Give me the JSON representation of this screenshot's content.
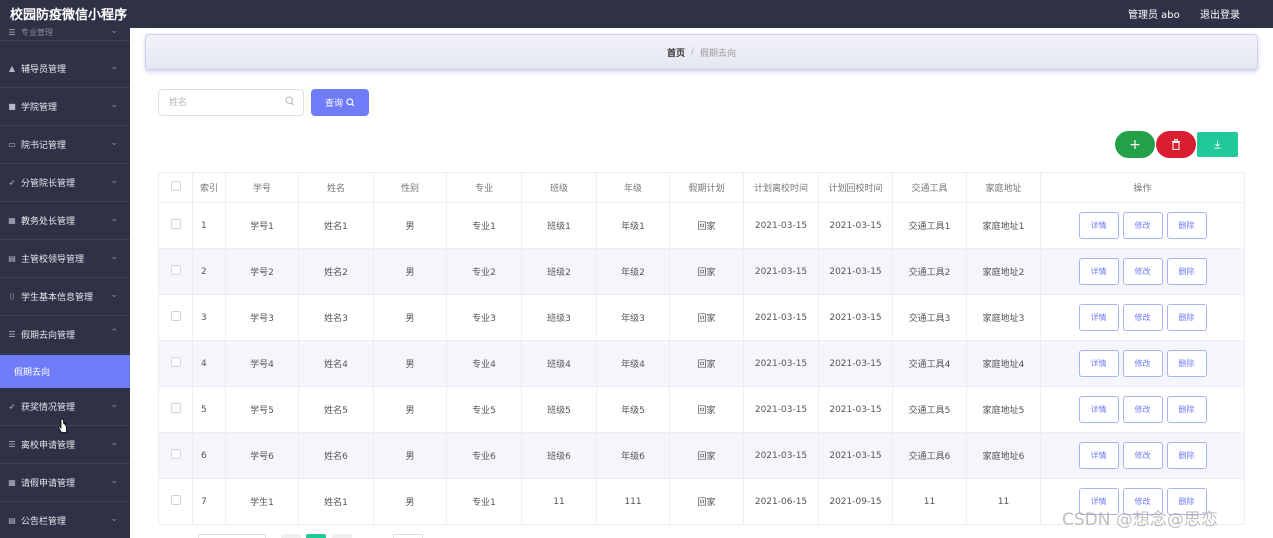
{
  "header": {
    "app_title": "校园防疫微信小程序",
    "admin_label": "管理员 abo",
    "logout_label": "退出登录"
  },
  "sidebar": {
    "items": [
      {
        "label": "专业管理",
        "icon": "list-icon"
      },
      {
        "label": "辅导员管理",
        "icon": "bank-icon"
      },
      {
        "label": "学院管理",
        "icon": "building-icon"
      },
      {
        "label": "院书记管理",
        "icon": "card-icon"
      },
      {
        "label": "分管院长管理",
        "icon": "send-icon"
      },
      {
        "label": "教务处长管理",
        "icon": "table-icon"
      },
      {
        "label": "主管校领导管理",
        "icon": "doc-icon"
      },
      {
        "label": "学生基本信息管理",
        "icon": "frame-icon"
      },
      {
        "label": "假期去向管理",
        "icon": "list-icon"
      },
      {
        "label": "获奖情况管理",
        "icon": "send-icon"
      },
      {
        "label": "离校申请管理",
        "icon": "list-icon"
      },
      {
        "label": "请假申请管理",
        "icon": "grid-icon"
      },
      {
        "label": "公告栏管理",
        "icon": "doc-icon"
      }
    ],
    "active_sub": "假期去向"
  },
  "breadcrumb": {
    "home": "首页",
    "separator": "/",
    "current": "假期去向"
  },
  "search": {
    "placeholder": "姓名",
    "value": "",
    "button_label": "查询"
  },
  "actions": {
    "add": "+",
    "delete_icon": "trash-icon",
    "download_icon": "download-icon"
  },
  "table": {
    "columns": [
      "",
      "索引",
      "学号",
      "姓名",
      "性别",
      "专业",
      "班级",
      "年级",
      "假期计划",
      "计划离校时间",
      "计划回校时间",
      "交通工具",
      "家庭地址",
      "操作"
    ],
    "rows": [
      [
        "1",
        "学号1",
        "姓名1",
        "男",
        "专业1",
        "班级1",
        "年级1",
        "回家",
        "2021-03-15",
        "2021-03-15",
        "交通工具1",
        "家庭地址1"
      ],
      [
        "2",
        "学号2",
        "姓名2",
        "男",
        "专业2",
        "班级2",
        "年级2",
        "回家",
        "2021-03-15",
        "2021-03-15",
        "交通工具2",
        "家庭地址2"
      ],
      [
        "3",
        "学号3",
        "姓名3",
        "男",
        "专业3",
        "班级3",
        "年级3",
        "回家",
        "2021-03-15",
        "2021-03-15",
        "交通工具3",
        "家庭地址3"
      ],
      [
        "4",
        "学号4",
        "姓名4",
        "男",
        "专业4",
        "班级4",
        "年级4",
        "回家",
        "2021-03-15",
        "2021-03-15",
        "交通工具4",
        "家庭地址4"
      ],
      [
        "5",
        "学号5",
        "姓名5",
        "男",
        "专业5",
        "班级5",
        "年级5",
        "回家",
        "2021-03-15",
        "2021-03-15",
        "交通工具5",
        "家庭地址5"
      ],
      [
        "6",
        "学号6",
        "姓名6",
        "男",
        "专业6",
        "班级6",
        "年级6",
        "回家",
        "2021-03-15",
        "2021-03-15",
        "交通工具6",
        "家庭地址6"
      ],
      [
        "7",
        "学生1",
        "姓名1",
        "男",
        "专业1",
        "11",
        "111",
        "回家",
        "2021-06-15",
        "2021-09-15",
        "11",
        "11"
      ]
    ],
    "op_labels": {
      "detail": "详情",
      "edit": "修改",
      "delete": "删除"
    }
  },
  "watermark": "CSDN @想念@思恋",
  "colors": {
    "nav_bg": "#2f3147",
    "accent": "#6f7cf7",
    "add": "#24a148",
    "delete": "#d81e30",
    "download": "#20c997"
  }
}
